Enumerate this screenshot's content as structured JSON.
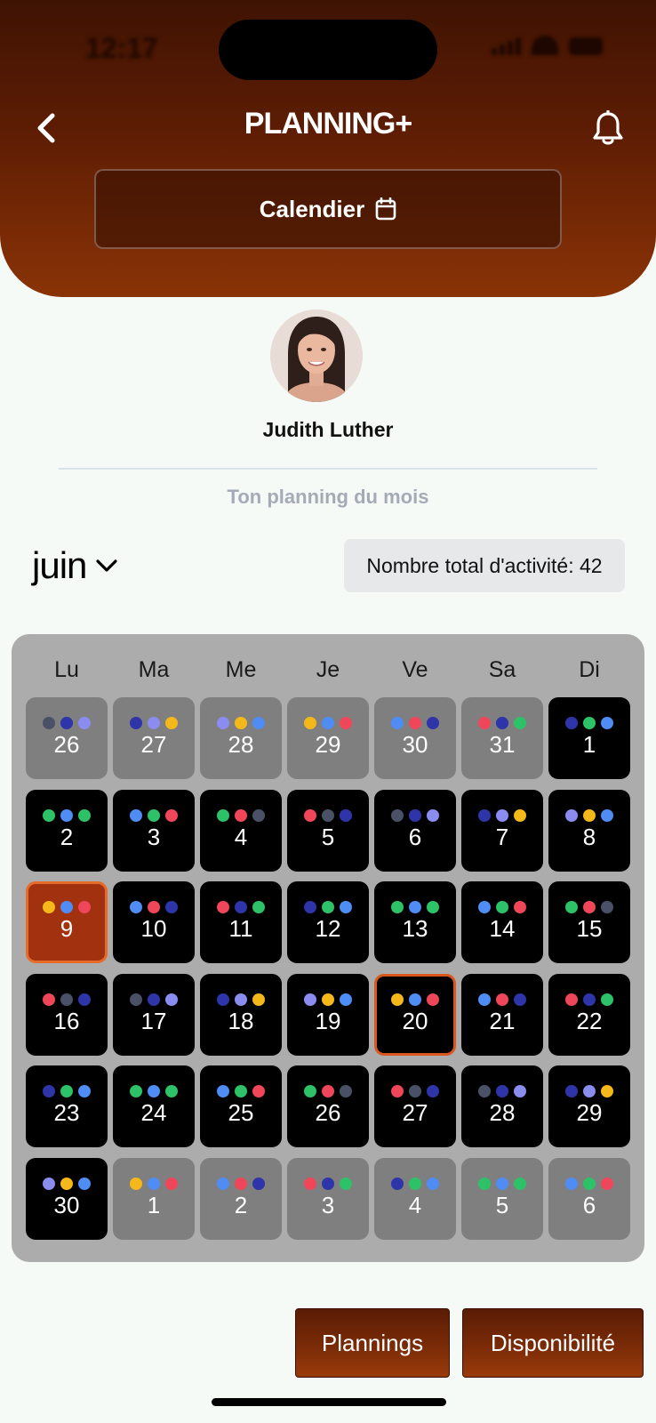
{
  "status_bar": {
    "time": "12:17"
  },
  "header": {
    "title": "PLANNING+",
    "calendar_button_label": "Calendier"
  },
  "profile": {
    "name": "Judith Luther",
    "subtitle": "Ton planning du mois"
  },
  "month": {
    "label": "juin"
  },
  "total": {
    "label": "Nombre total d'activité: 42"
  },
  "colors": {
    "accent": "#a1310f",
    "header_dark": "#3f1303",
    "dot_palette": {
      "navy": "#2d35a8",
      "slate": "#4a5166",
      "lavender": "#8b8cf0",
      "yellow": "#f5b81b",
      "blue": "#4f8cf4",
      "red": "#f0465a",
      "green": "#2ec268"
    }
  },
  "calendar": {
    "weekdays": [
      "Lu",
      "Ma",
      "Me",
      "Je",
      "Ve",
      "Sa",
      "Di"
    ],
    "days": [
      {
        "n": "26",
        "s": "other",
        "dots": [
          "slate",
          "navy",
          "lavender"
        ]
      },
      {
        "n": "27",
        "s": "other",
        "dots": [
          "navy",
          "lavender",
          "yellow"
        ]
      },
      {
        "n": "28",
        "s": "other",
        "dots": [
          "lavender",
          "yellow",
          "blue"
        ]
      },
      {
        "n": "29",
        "s": "other",
        "dots": [
          "yellow",
          "blue",
          "red"
        ]
      },
      {
        "n": "30",
        "s": "other",
        "dots": [
          "blue",
          "red",
          "navy"
        ]
      },
      {
        "n": "31",
        "s": "other",
        "dots": [
          "red",
          "navy",
          "green"
        ]
      },
      {
        "n": "1",
        "s": "current",
        "dots": [
          "navy",
          "green",
          "blue"
        ]
      },
      {
        "n": "2",
        "s": "current",
        "dots": [
          "green",
          "blue",
          "green"
        ]
      },
      {
        "n": "3",
        "s": "current",
        "dots": [
          "blue",
          "green",
          "red"
        ]
      },
      {
        "n": "4",
        "s": "current",
        "dots": [
          "green",
          "red",
          "slate"
        ]
      },
      {
        "n": "5",
        "s": "current",
        "dots": [
          "red",
          "slate",
          "navy"
        ]
      },
      {
        "n": "6",
        "s": "current",
        "dots": [
          "slate",
          "navy",
          "lavender"
        ]
      },
      {
        "n": "7",
        "s": "current",
        "dots": [
          "navy",
          "lavender",
          "yellow"
        ]
      },
      {
        "n": "8",
        "s": "current",
        "dots": [
          "lavender",
          "yellow",
          "blue"
        ]
      },
      {
        "n": "9",
        "s": "selected",
        "dots": [
          "yellow",
          "blue",
          "red"
        ]
      },
      {
        "n": "10",
        "s": "current",
        "dots": [
          "blue",
          "red",
          "navy"
        ]
      },
      {
        "n": "11",
        "s": "current",
        "dots": [
          "red",
          "navy",
          "green"
        ]
      },
      {
        "n": "12",
        "s": "current",
        "dots": [
          "navy",
          "green",
          "blue"
        ]
      },
      {
        "n": "13",
        "s": "current",
        "dots": [
          "green",
          "blue",
          "green"
        ]
      },
      {
        "n": "14",
        "s": "current",
        "dots": [
          "blue",
          "green",
          "red"
        ]
      },
      {
        "n": "15",
        "s": "current",
        "dots": [
          "green",
          "red",
          "slate"
        ]
      },
      {
        "n": "16",
        "s": "current",
        "dots": [
          "red",
          "slate",
          "navy"
        ]
      },
      {
        "n": "17",
        "s": "current",
        "dots": [
          "slate",
          "navy",
          "lavender"
        ]
      },
      {
        "n": "18",
        "s": "current",
        "dots": [
          "navy",
          "lavender",
          "yellow"
        ]
      },
      {
        "n": "19",
        "s": "current",
        "dots": [
          "lavender",
          "yellow",
          "blue"
        ]
      },
      {
        "n": "20",
        "s": "today",
        "dots": [
          "yellow",
          "blue",
          "red"
        ]
      },
      {
        "n": "21",
        "s": "current",
        "dots": [
          "blue",
          "red",
          "navy"
        ]
      },
      {
        "n": "22",
        "s": "current",
        "dots": [
          "red",
          "navy",
          "green"
        ]
      },
      {
        "n": "23",
        "s": "current",
        "dots": [
          "navy",
          "green",
          "blue"
        ]
      },
      {
        "n": "24",
        "s": "current",
        "dots": [
          "green",
          "blue",
          "green"
        ]
      },
      {
        "n": "25",
        "s": "current",
        "dots": [
          "blue",
          "green",
          "red"
        ]
      },
      {
        "n": "26",
        "s": "current",
        "dots": [
          "green",
          "red",
          "slate"
        ]
      },
      {
        "n": "27",
        "s": "current",
        "dots": [
          "red",
          "slate",
          "navy"
        ]
      },
      {
        "n": "28",
        "s": "current",
        "dots": [
          "slate",
          "navy",
          "lavender"
        ]
      },
      {
        "n": "29",
        "s": "current",
        "dots": [
          "navy",
          "lavender",
          "yellow"
        ]
      },
      {
        "n": "30",
        "s": "current",
        "dots": [
          "lavender",
          "yellow",
          "blue"
        ]
      },
      {
        "n": "1",
        "s": "other",
        "dots": [
          "yellow",
          "blue",
          "red"
        ]
      },
      {
        "n": "2",
        "s": "other",
        "dots": [
          "blue",
          "red",
          "navy"
        ]
      },
      {
        "n": "3",
        "s": "other",
        "dots": [
          "red",
          "navy",
          "green"
        ]
      },
      {
        "n": "4",
        "s": "other",
        "dots": [
          "navy",
          "green",
          "blue"
        ]
      },
      {
        "n": "5",
        "s": "other",
        "dots": [
          "green",
          "blue",
          "green"
        ]
      },
      {
        "n": "6",
        "s": "other",
        "dots": [
          "blue",
          "green",
          "red"
        ]
      }
    ]
  },
  "buttons": {
    "plannings": "Plannings",
    "disponibilite": "Disponibilité"
  }
}
